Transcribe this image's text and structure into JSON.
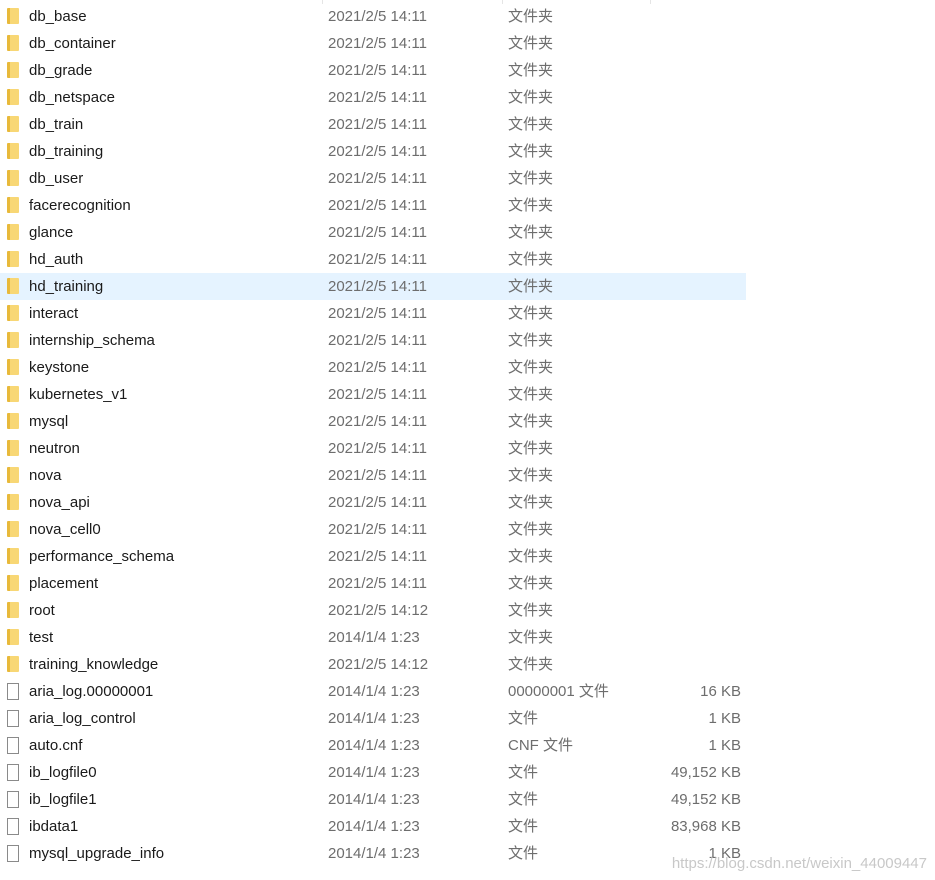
{
  "selected_index": 10,
  "rows": [
    {
      "name": "db_base",
      "date": "2021/2/5 14:11",
      "type": "文件夹",
      "size": "",
      "icon": "folder-icon"
    },
    {
      "name": "db_container",
      "date": "2021/2/5 14:11",
      "type": "文件夹",
      "size": "",
      "icon": "folder-icon"
    },
    {
      "name": "db_grade",
      "date": "2021/2/5 14:11",
      "type": "文件夹",
      "size": "",
      "icon": "folder-icon"
    },
    {
      "name": "db_netspace",
      "date": "2021/2/5 14:11",
      "type": "文件夹",
      "size": "",
      "icon": "folder-icon"
    },
    {
      "name": "db_train",
      "date": "2021/2/5 14:11",
      "type": "文件夹",
      "size": "",
      "icon": "folder-icon"
    },
    {
      "name": "db_training",
      "date": "2021/2/5 14:11",
      "type": "文件夹",
      "size": "",
      "icon": "folder-icon"
    },
    {
      "name": "db_user",
      "date": "2021/2/5 14:11",
      "type": "文件夹",
      "size": "",
      "icon": "folder-icon"
    },
    {
      "name": "facerecognition",
      "date": "2021/2/5 14:11",
      "type": "文件夹",
      "size": "",
      "icon": "folder-icon"
    },
    {
      "name": "glance",
      "date": "2021/2/5 14:11",
      "type": "文件夹",
      "size": "",
      "icon": "folder-icon"
    },
    {
      "name": "hd_auth",
      "date": "2021/2/5 14:11",
      "type": "文件夹",
      "size": "",
      "icon": "folder-icon"
    },
    {
      "name": "hd_training",
      "date": "2021/2/5 14:11",
      "type": "文件夹",
      "size": "",
      "icon": "folder-icon"
    },
    {
      "name": "interact",
      "date": "2021/2/5 14:11",
      "type": "文件夹",
      "size": "",
      "icon": "folder-icon"
    },
    {
      "name": "internship_schema",
      "date": "2021/2/5 14:11",
      "type": "文件夹",
      "size": "",
      "icon": "folder-icon"
    },
    {
      "name": "keystone",
      "date": "2021/2/5 14:11",
      "type": "文件夹",
      "size": "",
      "icon": "folder-icon"
    },
    {
      "name": "kubernetes_v1",
      "date": "2021/2/5 14:11",
      "type": "文件夹",
      "size": "",
      "icon": "folder-icon"
    },
    {
      "name": "mysql",
      "date": "2021/2/5 14:11",
      "type": "文件夹",
      "size": "",
      "icon": "folder-icon"
    },
    {
      "name": "neutron",
      "date": "2021/2/5 14:11",
      "type": "文件夹",
      "size": "",
      "icon": "folder-icon"
    },
    {
      "name": "nova",
      "date": "2021/2/5 14:11",
      "type": "文件夹",
      "size": "",
      "icon": "folder-icon"
    },
    {
      "name": "nova_api",
      "date": "2021/2/5 14:11",
      "type": "文件夹",
      "size": "",
      "icon": "folder-icon"
    },
    {
      "name": "nova_cell0",
      "date": "2021/2/5 14:11",
      "type": "文件夹",
      "size": "",
      "icon": "folder-icon"
    },
    {
      "name": "performance_schema",
      "date": "2021/2/5 14:11",
      "type": "文件夹",
      "size": "",
      "icon": "folder-icon"
    },
    {
      "name": "placement",
      "date": "2021/2/5 14:11",
      "type": "文件夹",
      "size": "",
      "icon": "folder-icon"
    },
    {
      "name": "root",
      "date": "2021/2/5 14:12",
      "type": "文件夹",
      "size": "",
      "icon": "folder-icon"
    },
    {
      "name": "test",
      "date": "2014/1/4 1:23",
      "type": "文件夹",
      "size": "",
      "icon": "folder-icon"
    },
    {
      "name": "training_knowledge",
      "date": "2021/2/5 14:12",
      "type": "文件夹",
      "size": "",
      "icon": "folder-icon"
    },
    {
      "name": "aria_log.00000001",
      "date": "2014/1/4 1:23",
      "type": "00000001 文件",
      "size": "16 KB",
      "icon": "file-icon"
    },
    {
      "name": "aria_log_control",
      "date": "2014/1/4 1:23",
      "type": "文件",
      "size": "1 KB",
      "icon": "file-icon"
    },
    {
      "name": "auto.cnf",
      "date": "2014/1/4 1:23",
      "type": "CNF 文件",
      "size": "1 KB",
      "icon": "file-icon"
    },
    {
      "name": "ib_logfile0",
      "date": "2014/1/4 1:23",
      "type": "文件",
      "size": "49,152 KB",
      "icon": "file-icon"
    },
    {
      "name": "ib_logfile1",
      "date": "2014/1/4 1:23",
      "type": "文件",
      "size": "49,152 KB",
      "icon": "file-icon"
    },
    {
      "name": "ibdata1",
      "date": "2014/1/4 1:23",
      "type": "文件",
      "size": "83,968 KB",
      "icon": "file-icon"
    },
    {
      "name": "mysql_upgrade_info",
      "date": "2014/1/4 1:23",
      "type": "文件",
      "size": "1 KB",
      "icon": "file-icon"
    }
  ],
  "watermark": "https://blog.csdn.net/weixin_44009447",
  "colors": {
    "selection": "#e5f3ff",
    "folder": "#f8d775",
    "secondary_text": "#6d6d6d"
  }
}
